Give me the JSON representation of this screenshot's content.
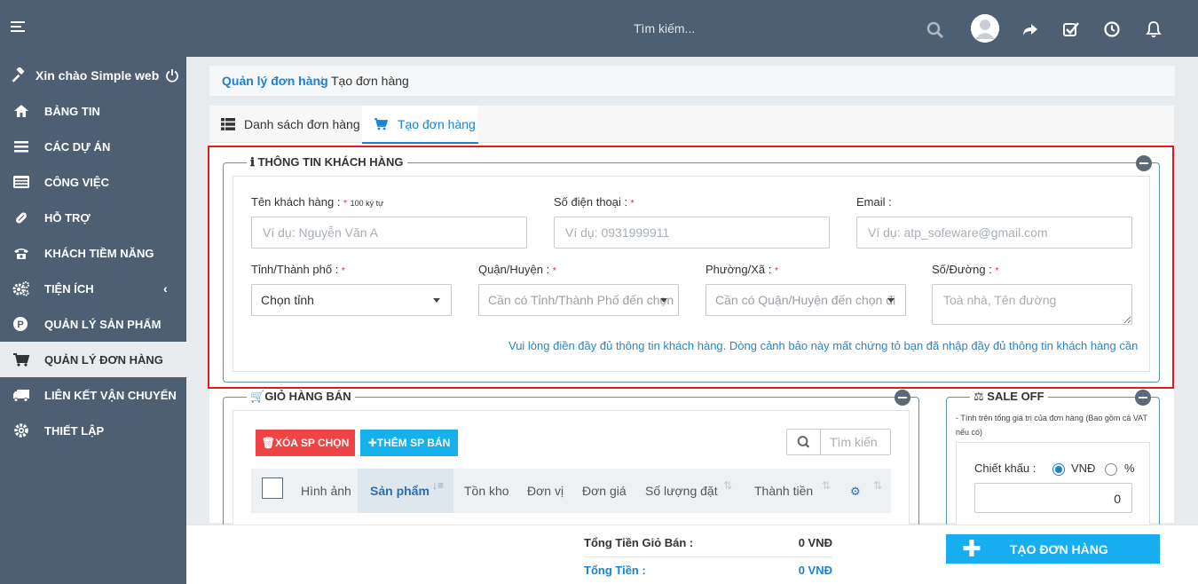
{
  "topbar": {
    "search_placeholder": "Tìm kiếm..."
  },
  "sidebar": {
    "greeting": "Xin chào Simple web",
    "items": [
      {
        "label": "Bảng tin",
        "icon": "home-icon"
      },
      {
        "label": "Các dự án",
        "icon": "list-icon"
      },
      {
        "label": "Công việc",
        "icon": "tasks-icon"
      },
      {
        "label": "Hỗ trợ",
        "icon": "medkit-icon"
      },
      {
        "label": "Khách tiềm năng",
        "icon": "phone-icon"
      },
      {
        "label": "Tiện ích",
        "icon": "cogs-icon"
      },
      {
        "label": "Quản lý sản phẩm",
        "icon": "product-p-icon"
      },
      {
        "label": "Quản lý đơn hàng",
        "icon": "cart-icon"
      },
      {
        "label": "Liên kết vận chuyển",
        "icon": "truck-icon"
      },
      {
        "label": "Thiết lập",
        "icon": "gear-icon"
      }
    ],
    "active_index": 7
  },
  "breadcrumb": {
    "parent": "Quản lý đơn hàng",
    "separator": "/",
    "current": "Tạo đơn hàng"
  },
  "tabs": [
    {
      "label": "Danh sách đơn hàng",
      "icon": "list-table-icon"
    },
    {
      "label": "Tạo đơn hàng",
      "icon": "cart-icon"
    }
  ],
  "customer": {
    "legend": "THÔNG TIN KHÁCH HÀNG",
    "name_label": "Tên khách hàng :",
    "name_required": "*",
    "name_hint": "100 ký tự",
    "name_placeholder": "Ví dụ: Nguyễn Văn A",
    "phone_label": "Số điện thoại :",
    "phone_required": "*",
    "phone_placeholder": "Ví dụ: 0931999911",
    "email_label": "Email :",
    "email_placeholder": "Ví dụ: atp_sofeware@gmail.com",
    "province_label": "Tỉnh/Thành phố :",
    "province_required": "*",
    "province_value": "Chọn tỉnh",
    "district_label": "Quận/Huyện :",
    "district_required": "*",
    "district_value": "Cần có Tỉnh/Thành Phố đến chọn",
    "ward_label": "Phường/Xã :",
    "ward_required": "*",
    "ward_value": "Cần có Quận/Huyện đến chọn đi",
    "street_label": "Số/Đường :",
    "street_required": "*",
    "street_placeholder": "Toà nhà, Tên đường",
    "notice": "Vui lòng điền đầy đủ thông tin khách hàng. Dòng cảnh bảo này mất chứng tỏ bạn đã nhập đầy đủ thông tin khách hàng cần"
  },
  "cart": {
    "legend": "GIỎ HÀNG BÁN",
    "delete_btn": "XÓA SP CHỌN",
    "add_btn": "THÊM SP BÁN",
    "search_placeholder": "Tìm kiến",
    "columns": [
      "Hình ảnh",
      "Sản phẩm",
      "Tồn kho",
      "Đơn vị",
      "Đơn giá",
      "Số lượng đặt",
      "Thành tiền"
    ]
  },
  "sale": {
    "legend": "SALE OFF",
    "note": "- Tính trên tổng giá trị của đơn hàng (Bao gồm cả VAT nếu có)",
    "discount_label": "Chiết khấu :",
    "opt_vnd": "VNĐ",
    "opt_pct": "%",
    "discount_value": "0"
  },
  "footer": {
    "cart_total_label": "Tổng Tiền Giỏ Bán :",
    "cart_total_value": "0 VNĐ",
    "total_label": "Tổng Tiền :",
    "total_value": "0 VNĐ",
    "create_btn": "TẠO ĐƠN HÀNG"
  },
  "colors": {
    "sidebar": "#4f5f73",
    "accent": "#1a82d1",
    "danger": "#f04343",
    "info": "#16b0ea",
    "highlight": "#e01c1c"
  }
}
